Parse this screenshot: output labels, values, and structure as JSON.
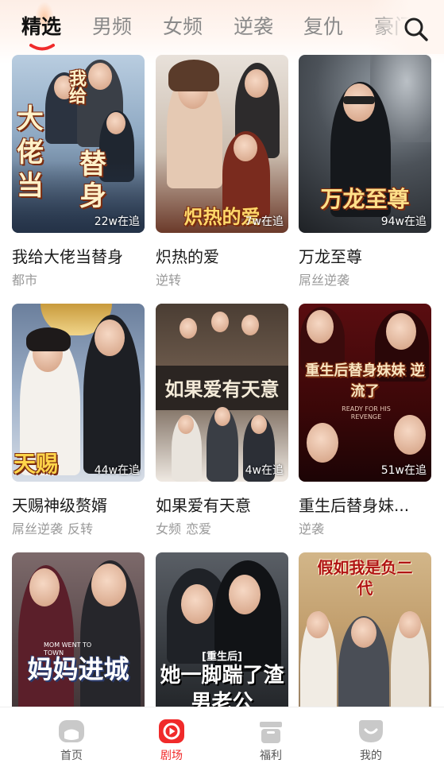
{
  "tabs": [
    {
      "label": "精选",
      "active": true
    },
    {
      "label": "男频",
      "active": false
    },
    {
      "label": "女频",
      "active": false
    },
    {
      "label": "逆袭",
      "active": false
    },
    {
      "label": "复仇",
      "active": false
    },
    {
      "label": "豪门",
      "active": false
    }
  ],
  "search": {
    "icon": "search-icon"
  },
  "cards": [
    {
      "title": "我给大佬当替身",
      "poster_text": "我给大佬当替身",
      "followers": "22w在追",
      "tags": [
        "都市"
      ]
    },
    {
      "title": "炽热的爱",
      "poster_text": "炽热的爱",
      "followers": "7w在追",
      "tags": [
        "逆转"
      ]
    },
    {
      "title": "万龙至尊",
      "poster_text": "万龙至尊",
      "followers": "94w在追",
      "tags": [
        "屌丝逆袭"
      ]
    },
    {
      "title": "天赐神级赘婿",
      "poster_text": "天赐神级赘婿",
      "followers": "44w在追",
      "tags": [
        "屌丝逆袭",
        "反转"
      ]
    },
    {
      "title": "如果爱有天意",
      "poster_text": "如果爱有天意",
      "followers": "4w在追",
      "tags": [
        "女频",
        "恋爱"
      ]
    },
    {
      "title": "重生后替身妹...",
      "poster_text": "重生后替身妹妹 逆流了",
      "poster_subtext": "READY FOR HIS REVENGE",
      "followers": "51w在追",
      "tags": [
        "逆袭"
      ]
    },
    {
      "title": "",
      "poster_text": "妈妈进城",
      "poster_subtext": "MOM WENT TO TOWN",
      "followers": "",
      "tags": []
    },
    {
      "title": "",
      "poster_text": "她一脚踹了渣男老公",
      "poster_badge": "[重生后]",
      "followers": "",
      "tags": []
    },
    {
      "title": "",
      "poster_text": "假如我是负二代",
      "followers": "",
      "tags": []
    }
  ],
  "bottom_nav": [
    {
      "label": "首页",
      "icon": "home-icon",
      "active": false
    },
    {
      "label": "剧场",
      "icon": "theater-play-icon",
      "active": true
    },
    {
      "label": "福利",
      "icon": "gift-icon",
      "active": false
    },
    {
      "label": "我的",
      "icon": "profile-icon",
      "active": false
    }
  ],
  "colors": {
    "accent": "#f02a2a",
    "tab_inactive": "#8a8a8a",
    "tag": "#999999"
  }
}
